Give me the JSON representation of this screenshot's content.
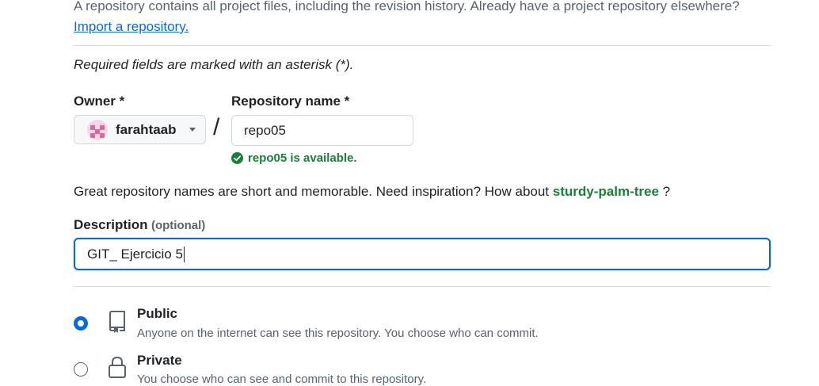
{
  "intro": {
    "text": "A repository contains all project files, including the revision history. Already have a project repository elsewhere?",
    "import_link": "Import a repository."
  },
  "required_note": "Required fields are marked with an asterisk (*).",
  "owner": {
    "label": "Owner *",
    "value": "farahtaab"
  },
  "separator": "/",
  "repo_name": {
    "label": "Repository name *",
    "value": "repo05",
    "availability": "repo05 is available."
  },
  "suggestion": {
    "text": "Great repository names are short and memorable. Need inspiration? How about",
    "name": "sturdy-palm-tree",
    "suffix": "?"
  },
  "description": {
    "label": "Description",
    "optional": "(optional)",
    "value": "GIT_ Ejercicio 5"
  },
  "visibility": {
    "public": {
      "title": "Public",
      "desc": "Anyone on the internet can see this repository. You choose who can commit.",
      "icon": "repo-icon",
      "selected": true
    },
    "private": {
      "title": "Private",
      "desc": "You choose who can see and commit to this repository.",
      "icon": "lock-icon",
      "selected": false
    }
  },
  "colors": {
    "accent": "#0969da",
    "success": "#1a7f37",
    "muted": "#59636e"
  }
}
